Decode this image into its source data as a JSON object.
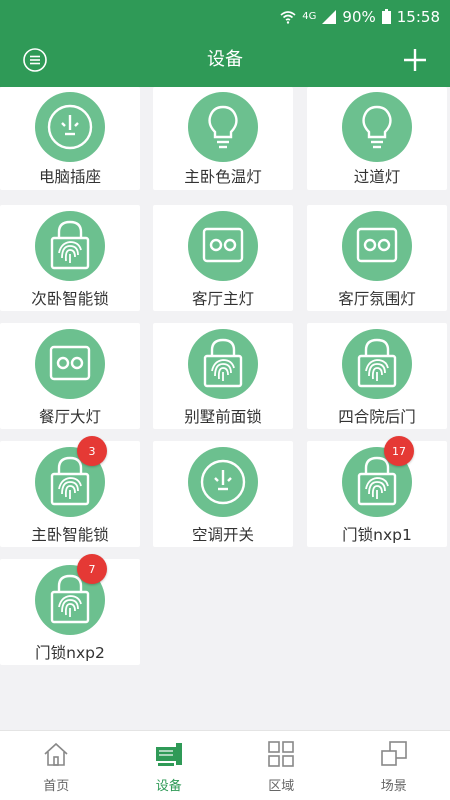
{
  "status_bar": {
    "network": "4G",
    "battery": "90%",
    "time": "15:58"
  },
  "app_bar": {
    "title": "设备"
  },
  "devices": [
    {
      "label": "电脑插座",
      "icon": "power-socket-icon"
    },
    {
      "label": "主卧色温灯",
      "icon": "light-bulb-icon"
    },
    {
      "label": "过道灯",
      "icon": "light-bulb-icon"
    },
    {
      "label": "次卧智能锁",
      "icon": "fingerprint-lock-icon"
    },
    {
      "label": "客厅主灯",
      "icon": "wall-switch-icon"
    },
    {
      "label": "客厅氛围灯",
      "icon": "wall-switch-icon"
    },
    {
      "label": "餐厅大灯",
      "icon": "wall-switch-icon"
    },
    {
      "label": "别墅前面锁",
      "icon": "fingerprint-lock-icon"
    },
    {
      "label": "四合院后门",
      "icon": "fingerprint-lock-icon"
    },
    {
      "label": "主卧智能锁",
      "icon": "fingerprint-lock-icon",
      "badge": "3"
    },
    {
      "label": "空调开关",
      "icon": "power-socket-icon"
    },
    {
      "label": "门锁nxp1",
      "icon": "fingerprint-lock-icon",
      "badge": "17"
    },
    {
      "label": "门锁nxp2",
      "icon": "fingerprint-lock-icon",
      "badge": "7"
    }
  ],
  "tabs": [
    {
      "label": "首页",
      "icon": "home-icon"
    },
    {
      "label": "设备",
      "icon": "device-icon"
    },
    {
      "label": "区域",
      "icon": "grid-icon"
    },
    {
      "label": "场景",
      "icon": "scene-icon"
    }
  ],
  "active_tab": 1,
  "colors": {
    "primary": "#2f9a57",
    "device_circle": "#6cc08f",
    "badge": "#e53935"
  }
}
